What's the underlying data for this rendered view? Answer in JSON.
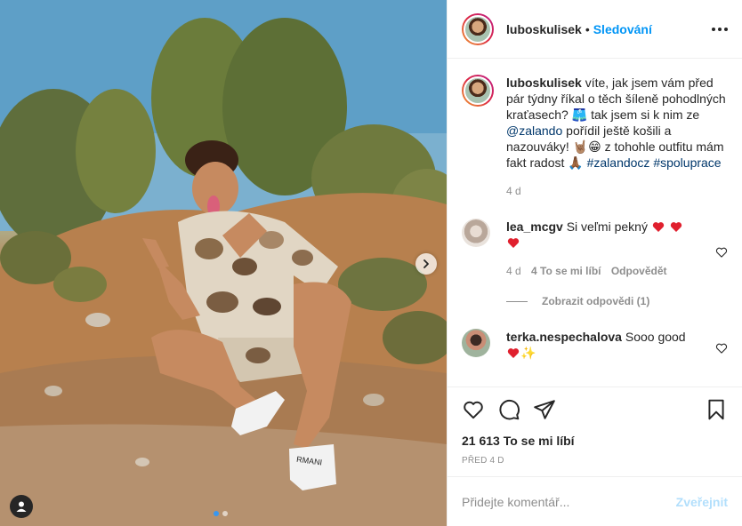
{
  "post": {
    "author": "luboskulisek",
    "separator": "•",
    "follow_label": "Sledování",
    "caption": {
      "text_1": "víte, jak jsem vám před pár týdny říkal o těch šíleně pohodlných kraťasech?",
      "emoji_shorts": "🩳",
      "text_2": "tak jsem si k nim ze",
      "mention": "@zalando",
      "text_3": "pořídil ještě košili a nazouváky!",
      "emoji_rock": "🤘🏽",
      "emoji_grin": "😁",
      "text_4": "z tohohle outfitu mám fakt radost",
      "emoji_pray": "🙏🏾",
      "hashtag_1": "#zalandocz",
      "hashtag_2": "#spoluprace",
      "age": "4 d"
    },
    "comments": [
      {
        "user": "lea_mcgv",
        "text": "Si veľmi pekný",
        "age": "4 d",
        "likes": "4 To se mi líbí",
        "reply_label": "Odpovědět",
        "view_replies": "Zobrazit odpovědi (1)"
      },
      {
        "user": "terka.nespechalova",
        "text": "Sooo good",
        "emoji_sparkles": "✨"
      }
    ],
    "likes_text": "21 613 To se mi líbí",
    "date_text": "PŘED 4 D",
    "comment_placeholder": "Přidejte komentář...",
    "publish_label": "Zveřejnit"
  },
  "colors": {
    "accent": "#0095f6",
    "heart": "#ed4956",
    "muted": "#8e8e8e",
    "disabled_blue": "#b2dffc"
  },
  "icons": [
    "more-options-icon",
    "heart-icon",
    "comment-icon",
    "share-icon",
    "bookmark-icon",
    "chevron-right-icon",
    "user-tag-icon"
  ]
}
